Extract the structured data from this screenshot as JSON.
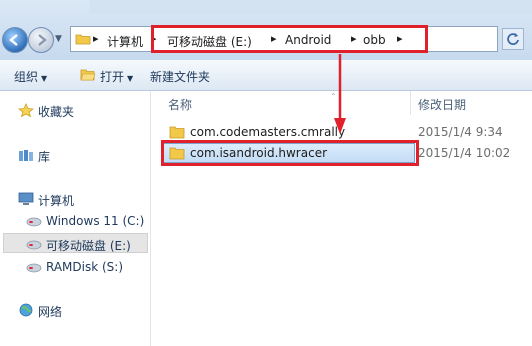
{
  "address_bar": {
    "breadcrumbs": [
      {
        "label": "计算机"
      },
      {
        "label": "可移动磁盘 (E:)"
      },
      {
        "label": "Android"
      },
      {
        "label": "obb"
      }
    ]
  },
  "toolbar": {
    "organize_label": "组织",
    "open_label": "打开",
    "new_folder_label": "新建文件夹"
  },
  "nav": {
    "favorites": "收藏夹",
    "libraries": "库",
    "computer": "计算机",
    "drives": [
      {
        "label": "Windows 11 (C:)"
      },
      {
        "label": "可移动磁盘 (E:)"
      },
      {
        "label": "RAMDisk (S:)"
      }
    ],
    "network": "网络"
  },
  "columns": {
    "name": "名称",
    "date": "修改日期"
  },
  "files": [
    {
      "name": "com.codemasters.cmrally",
      "date": "2015/1/4 9:34"
    },
    {
      "name": "com.isandroid.hwracer",
      "date": "2015/1/4 10:02"
    }
  ],
  "colors": {
    "annotation_red": "#e0202a",
    "folder_yellow": "#f2c84b",
    "selection_blue": "#c3dcf5"
  }
}
